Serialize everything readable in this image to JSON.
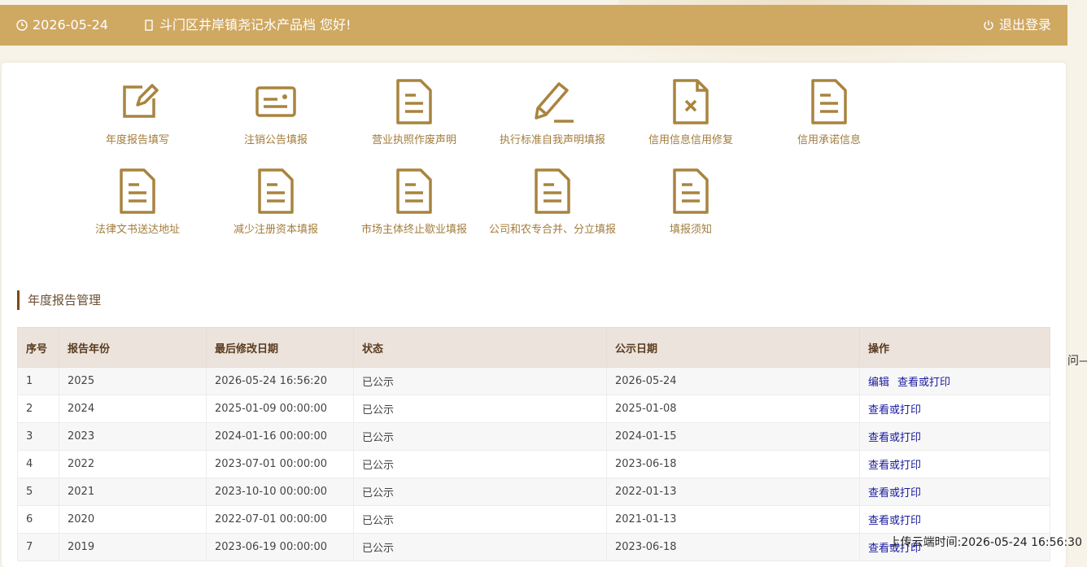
{
  "header": {
    "date": "2026-05-24",
    "greeting": "斗门区井岸镇尧记水产品档 您好!",
    "logout_label": "退出登录"
  },
  "functions_row1": [
    {
      "label": "年度报告填写",
      "icon": "edit-icon"
    },
    {
      "label": "注销公告填报",
      "icon": "id-card-icon"
    },
    {
      "label": "营业执照作废声明",
      "icon": "document-icon"
    },
    {
      "label": "执行标准自我声明填报",
      "icon": "pencil-icon"
    },
    {
      "label": "信用信息信用修复",
      "icon": "document-x-icon"
    },
    {
      "label": "信用承诺信息",
      "icon": "document-icon"
    }
  ],
  "functions_row2": [
    {
      "label": "法律文书送达地址",
      "icon": "document-icon"
    },
    {
      "label": "减少注册资本填报",
      "icon": "document-icon"
    },
    {
      "label": "市场主体终止歇业填报",
      "icon": "document-icon"
    },
    {
      "label": "公司和农专合并、分立填报",
      "icon": "document-icon"
    },
    {
      "label": "填报须知",
      "icon": "document-icon"
    }
  ],
  "section": {
    "title": "年度报告管理"
  },
  "table": {
    "headers": [
      "序号",
      "报告年份",
      "最后修改日期",
      "状态",
      "公示日期",
      "操作"
    ],
    "rows": [
      {
        "no": "1",
        "year": "2025",
        "modified": "2026-05-24 16:56:20",
        "status": "已公示",
        "pub": "2026-05-24",
        "ops": [
          "编辑",
          "查看或打印"
        ]
      },
      {
        "no": "2",
        "year": "2024",
        "modified": "2025-01-09 00:00:00",
        "status": "已公示",
        "pub": "2025-01-08",
        "ops": [
          "查看或打印"
        ]
      },
      {
        "no": "3",
        "year": "2023",
        "modified": "2024-01-16 00:00:00",
        "status": "已公示",
        "pub": "2024-01-15",
        "ops": [
          "查看或打印"
        ]
      },
      {
        "no": "4",
        "year": "2022",
        "modified": "2023-07-01 00:00:00",
        "status": "已公示",
        "pub": "2023-06-18",
        "ops": [
          "查看或打印"
        ]
      },
      {
        "no": "5",
        "year": "2021",
        "modified": "2023-10-10 00:00:00",
        "status": "已公示",
        "pub": "2022-01-13",
        "ops": [
          "查看或打印"
        ]
      },
      {
        "no": "6",
        "year": "2020",
        "modified": "2022-07-01 00:00:00",
        "status": "已公示",
        "pub": "2021-01-13",
        "ops": [
          "查看或打印"
        ]
      },
      {
        "no": "7",
        "year": "2019",
        "modified": "2023-06-19 00:00:00",
        "status": "已公示",
        "pub": "2023-06-18",
        "ops": [
          "查看或打印"
        ]
      }
    ]
  },
  "side_text": "问—",
  "upload_time": "上传云端时间:2026-05-24 16:56:30",
  "colors": {
    "header_bg": "#cfa862",
    "icon": "#a8843e",
    "label": "#a27c3c",
    "link": "#1a1a9e",
    "table_header_bg": "#ebe3dc"
  }
}
